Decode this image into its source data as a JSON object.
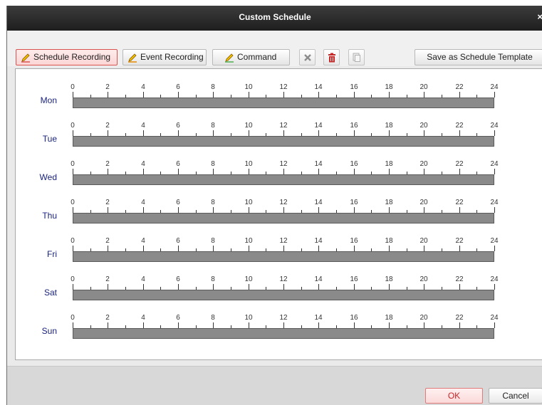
{
  "window": {
    "title": "Custom Schedule",
    "close_glyph": "×"
  },
  "toolbar": {
    "schedule_recording": "Schedule Recording",
    "event_recording": "Event Recording",
    "command": "Command",
    "save_template": "Save as Schedule Template",
    "icons": [
      "delete-x-icon",
      "trash-icon",
      "copy-icon"
    ]
  },
  "schedule": {
    "days": [
      "Mon",
      "Tue",
      "Wed",
      "Thu",
      "Fri",
      "Sat",
      "Sun"
    ],
    "hour_labels": [
      "0",
      "2",
      "4",
      "6",
      "8",
      "10",
      "12",
      "14",
      "16",
      "18",
      "20",
      "22",
      "24"
    ],
    "bar_color": "#8a8a8a"
  },
  "footer": {
    "ok": "OK",
    "cancel": "Cancel"
  },
  "colors": {
    "active_border": "#d9534f",
    "day_label": "#1a237e",
    "pencil_yellow": "#f2c200"
  }
}
